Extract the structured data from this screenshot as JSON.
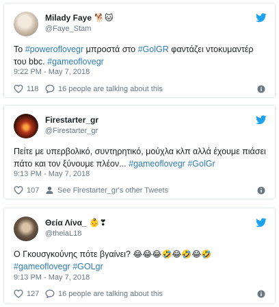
{
  "tweets": [
    {
      "name": "Milady Faye",
      "name_emoji": "🐕🐱",
      "handle": "@Faye_Stam",
      "text_parts": [
        {
          "t": "Το ",
          "tag": false
        },
        {
          "t": "#poweroflovegr",
          "tag": true
        },
        {
          "t": " μπροστά στο ",
          "tag": false
        },
        {
          "t": "#GolGR",
          "tag": true
        },
        {
          "t": " φαντάζει ντοκυμαντέρ του bbc. ",
          "tag": false
        },
        {
          "t": "#gameoflovegr",
          "tag": true
        }
      ],
      "time": "9:22 PM - May 7, 2018",
      "likes": "118",
      "secondary": "16 people are talking about this",
      "secondary_icon": "comment-icon"
    },
    {
      "name": "Firestarter_gr",
      "name_emoji": "",
      "handle": "@Firestarter_gr",
      "text_parts": [
        {
          "t": "Πείτε με υπερβολικό, συντηρητικό, μούχλα κλπ αλλά έχουμε πιάσει πάτο και τον ξύνουμε πλέον... ",
          "tag": false
        },
        {
          "t": "#gameoflovegr",
          "tag": true
        },
        {
          "t": " ",
          "tag": false
        },
        {
          "t": "#GolGr",
          "tag": true
        }
      ],
      "time": "9:13 PM - May 7, 2018",
      "likes": "107",
      "secondary": "See Firestarter_gr's other Tweets",
      "secondary_icon": "profile-icon"
    },
    {
      "name": "Θεία Λίνα_",
      "name_emoji": "👶❣",
      "handle": "@theiaL18",
      "text_parts": [
        {
          "t": "Ο Γκουσγκούνης πότε βγαίνει?  ",
          "tag": false
        },
        {
          "t": "😂😂😂🤣😂🤣😂🤣",
          "tag": false
        },
        {
          "t": " ",
          "tag": false
        },
        {
          "t": "#gameoflovegr",
          "tag": true
        },
        {
          "t": " ",
          "tag": false
        },
        {
          "t": "#GOLgr",
          "tag": true
        }
      ],
      "time": "9:13 PM - May 7, 2018",
      "likes": "127",
      "secondary": "16 people are talking about this",
      "secondary_icon": "comment-icon"
    }
  ],
  "colors": {
    "accent": "#1da1f2",
    "hashtag": "#2b7bb9",
    "muted": "#697882",
    "border": "#e1e8ed"
  }
}
